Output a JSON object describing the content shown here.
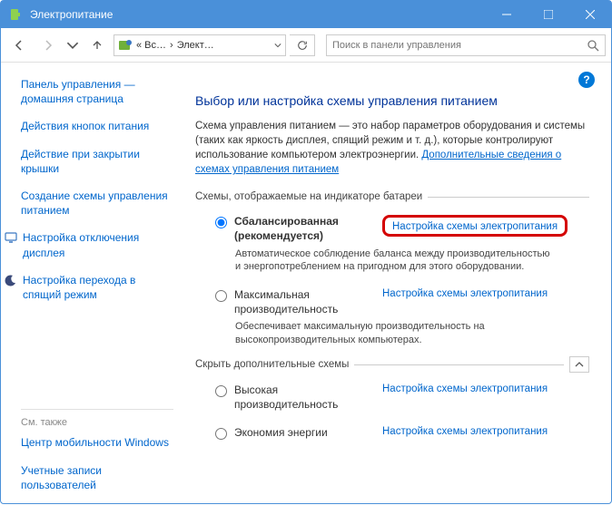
{
  "window": {
    "title": "Электропитание"
  },
  "nav": {
    "crumb1": "« Вс…",
    "crumb2": "Элект…",
    "search_placeholder": "Поиск в панели управления"
  },
  "sidebar": {
    "links": [
      "Панель управления — домашняя страница",
      "Действия кнопок питания",
      "Действие при закрытии крышки",
      "Создание схемы управления питанием",
      "Настройка отключения дисплея",
      "Настройка перехода в спящий режим"
    ],
    "see_also": "См. также",
    "footer": [
      "Центр мобильности Windows",
      "Учетные записи пользователей"
    ]
  },
  "main": {
    "heading": "Выбор или настройка схемы управления питанием",
    "desc1": "Схема управления питанием — это набор параметров оборудования и системы (таких как яркость дисплея, спящий режим и т. д.), которые контролируют использование компьютером электроэнергии. ",
    "desc_link": "Дополнительные сведения о схемах управления питанием",
    "group1": "Схемы, отображаемые на индикаторе батареи",
    "group2": "Скрыть дополнительные схемы",
    "plan_link": "Настройка схемы электропитания",
    "plans": [
      {
        "name_bold": "Сбалансированная (рекомендуется)",
        "desc": "Автоматическое соблюдение баланса между производительностью и энергопотреблением на пригодном для этого оборудовании.",
        "checked": true
      },
      {
        "name": "Максимальная производительность",
        "desc": "Обеспечивает максимальную производительность на высокопроизводительных компьютерах.",
        "checked": false
      }
    ],
    "extra_plans": [
      {
        "name": "Высокая производительность"
      },
      {
        "name": "Экономия энергии"
      }
    ]
  }
}
